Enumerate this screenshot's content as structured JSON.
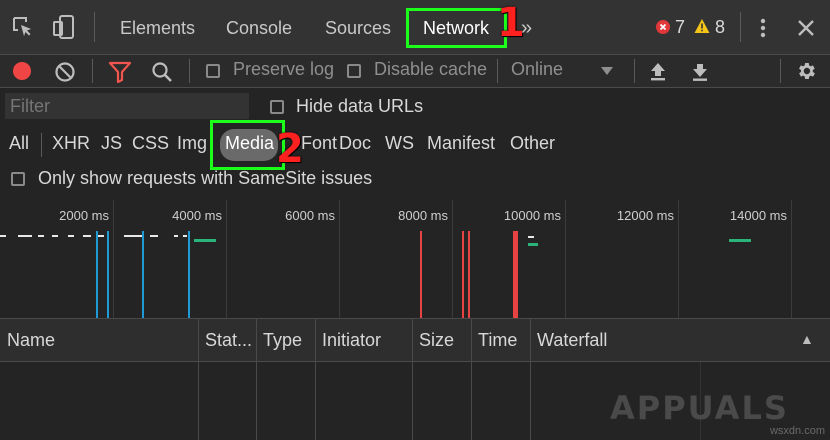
{
  "tabs": [
    "Elements",
    "Console",
    "Sources",
    "Network"
  ],
  "more_tabs_glyph": "»",
  "errors_count": "7",
  "warnings_count": "8",
  "step_labels": [
    "1",
    "2"
  ],
  "toolbar": {
    "preserve_log": "Preserve log",
    "disable_cache": "Disable cache",
    "throttle": "Online"
  },
  "filter": {
    "placeholder": "Filter",
    "hide_data_urls": "Hide data URLs",
    "types": [
      "All",
      "XHR",
      "JS",
      "CSS",
      "Img",
      "Media",
      "Font",
      "Doc",
      "WS",
      "Manifest",
      "Other"
    ],
    "samesite": "Only show requests with SameSite issues"
  },
  "timeline": {
    "ticks": [
      "2000 ms",
      "4000 ms",
      "6000 ms",
      "8000 ms",
      "10000 ms",
      "12000 ms",
      "14000 ms"
    ]
  },
  "columns": [
    "Name",
    "Stat...",
    "Type",
    "Initiator",
    "Size",
    "Time",
    "Waterfall"
  ],
  "sort_indicator": "▲",
  "watermark": "APPUALS",
  "watermark_site": "wsxdn.com",
  "colors": {
    "highlight": "#1bff1b",
    "step_number": "#ff2020",
    "record": "#f04545",
    "filter_icon": "#f0564e",
    "error": "#e0373a",
    "warning": "#f5c518",
    "bar_blue": "#1e9bd4",
    "bar_red": "#e84343",
    "bar_green": "#2ab37a"
  }
}
